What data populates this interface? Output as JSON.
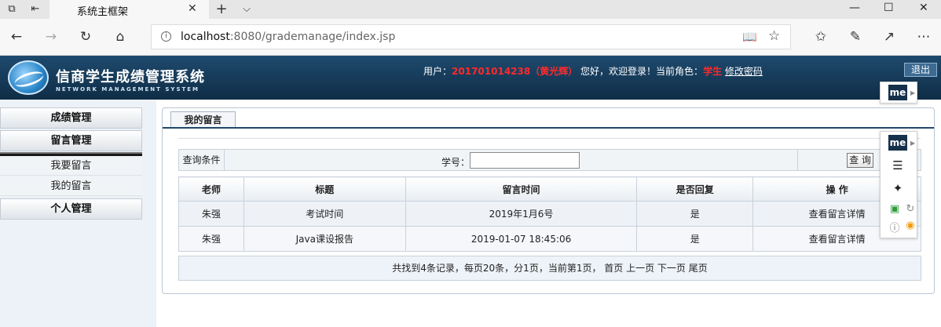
{
  "browser": {
    "tab_title": "系统主框架",
    "tab_close": "✕",
    "new_tab": "+",
    "tab_list": "⌵",
    "url_host": "localhost",
    "url_rest": ":8080/grademanage/index.jsp",
    "win_min": "—",
    "win_max": "☐",
    "win_close": "✕"
  },
  "app": {
    "title": "信商学生成绩管理系统",
    "subtitle": "NETWORK MANAGEMENT SYSTEM",
    "user_label": "用户：",
    "user_id": "201701014238（黄光辉）",
    "welcome": "您好，欢迎登录！当前角色：",
    "role": "学生",
    "change_pwd": "修改密码",
    "logout": "退出"
  },
  "sidebar": {
    "sections": [
      "成绩管理",
      "留言管理",
      "个人管理"
    ],
    "items": [
      "我要留言",
      "我的留言"
    ]
  },
  "main": {
    "tab": "我的留言",
    "query_label": "查询条件",
    "student_no_label": "学号：",
    "student_no_value": "",
    "query_button": "查 询",
    "columns": [
      "老师",
      "标题",
      "留言时间",
      "是否回复",
      "操 作"
    ],
    "rows": [
      [
        "朱强",
        "考试时间",
        "2019年1月6号",
        "是",
        "查看留言详情"
      ],
      [
        "朱强",
        "Java课设报告",
        "2019-01-07 18:45:06",
        "是",
        "查看留言详情"
      ]
    ],
    "pager": "共找到4条记录，每页20条，分1页，当前第1页， 首页 上一页 下一页 尾页"
  },
  "extension": {
    "badge": "me"
  }
}
